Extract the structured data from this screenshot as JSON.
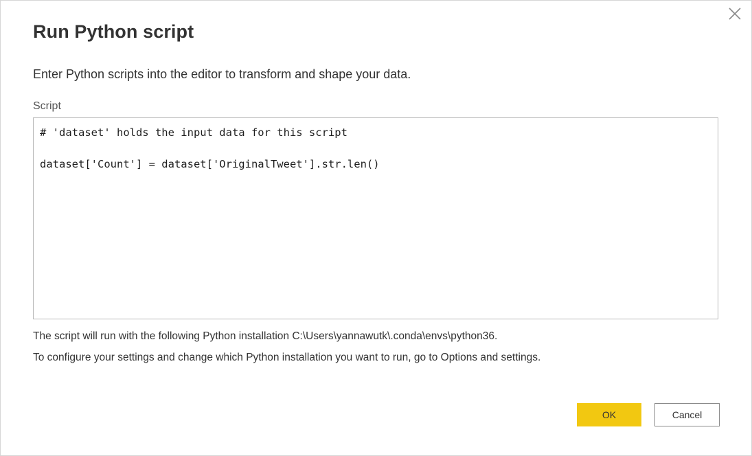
{
  "dialog": {
    "title": "Run Python script",
    "description": "Enter Python scripts into the editor to transform and shape your data.",
    "close_icon": "close-x-icon"
  },
  "editor": {
    "label": "Script",
    "lines": [
      "# 'dataset' holds the input data for this script",
      "dataset['Count'] = dataset['OriginalTweet'].str.len()"
    ]
  },
  "info": {
    "installation": "The script will run with the following Python installation C:\\Users\\yannawutk\\.conda\\envs\\python36.",
    "configure": "To configure your settings and change which Python installation you want to run, go to Options and settings."
  },
  "buttons": {
    "ok_label": "OK",
    "cancel_label": "Cancel"
  },
  "colors": {
    "primary_button": "#f2c811",
    "border": "#b8b8b8",
    "text": "#333333"
  }
}
